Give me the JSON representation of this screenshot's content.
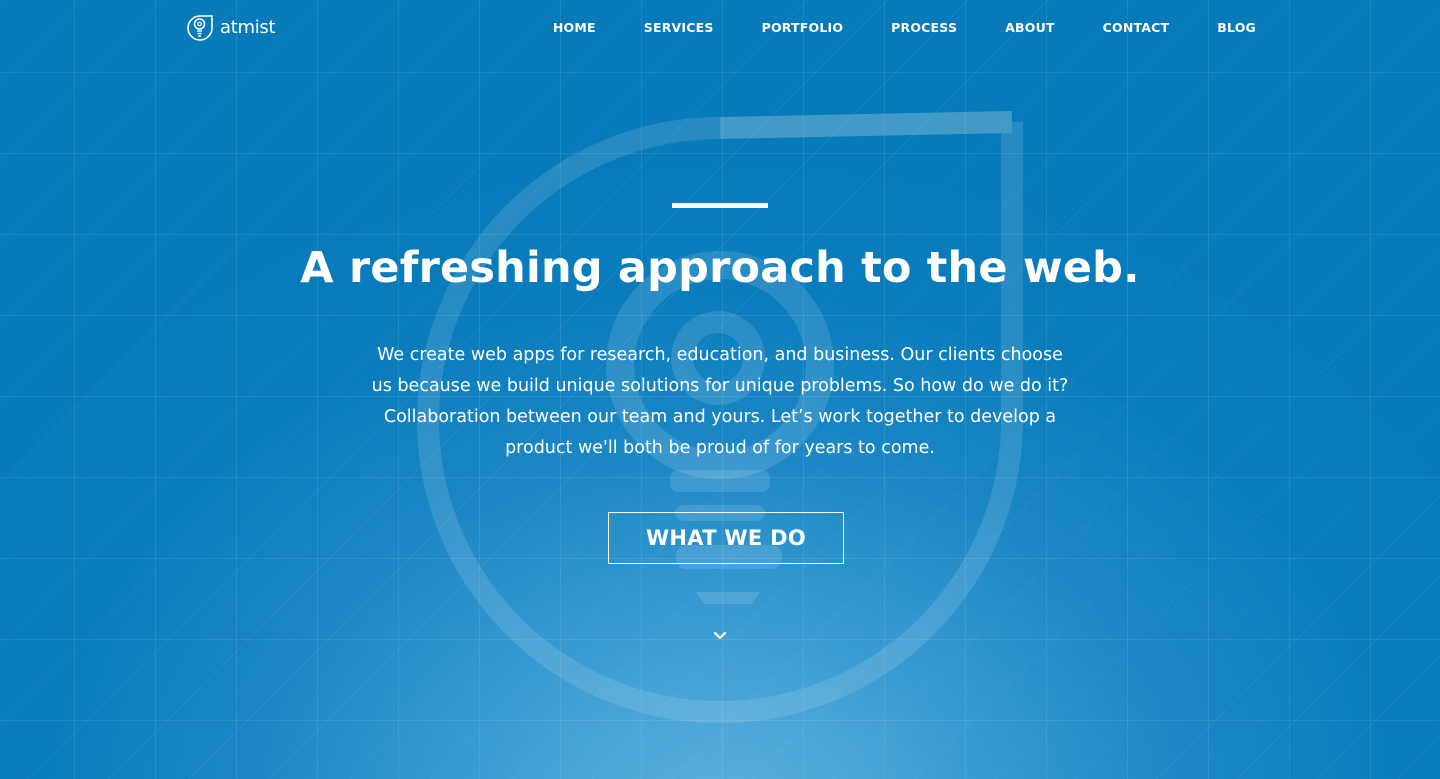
{
  "brand": {
    "name": "atmist",
    "logo_icon": "lightbulb-at-icon"
  },
  "nav": {
    "items": [
      {
        "label": "HOME"
      },
      {
        "label": "SERVICES"
      },
      {
        "label": "PORTFOLIO"
      },
      {
        "label": "PROCESS"
      },
      {
        "label": "ABOUT"
      },
      {
        "label": "CONTACT"
      },
      {
        "label": "BLOG"
      }
    ]
  },
  "hero": {
    "title": "A refreshing approach to the web.",
    "body": "We create web apps for research, education, and business. Our clients choose us because we build unique solutions for unique problems. So how do we do it? Collaboration between our team and yours. Let’s work together to develop a product we'll both be proud of for years to come.",
    "cta_label": "WHAT WE DO",
    "scroll_icon": "chevron-down-icon"
  },
  "colors": {
    "background": "#0a7cbc",
    "background_glow": "#5fb3de",
    "text": "#ffffff"
  }
}
